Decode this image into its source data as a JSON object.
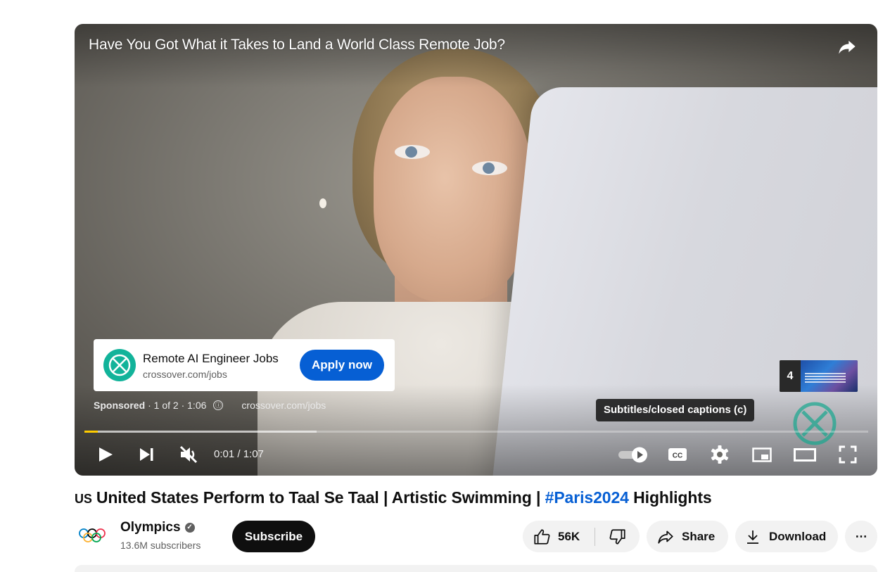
{
  "player": {
    "ad_title": "Have You Got What it Takes to Land a World Class Remote Job?",
    "ad_card": {
      "headline": "Remote AI Engineer Jobs",
      "domain": "crossover.com/jobs",
      "cta_label": "Apply now",
      "logo_icon": "crossover-logo-icon"
    },
    "sponsored": {
      "label": "Sponsored",
      "meta": "· 1 of 2 · 1:06",
      "info_icon": "ⓘ",
      "link": "crossover.com/jobs"
    },
    "preview": {
      "number": "4"
    },
    "tooltip": "Subtitles/closed captions (c)",
    "progress": {
      "played_fraction": 0.017,
      "buffered_fraction": 0.296
    },
    "time": "0:01 / 1:07",
    "accent_color": "#ffcc00"
  },
  "video": {
    "flag": "US",
    "title_main": "United States Perform to Taal Se Taal | Artistic Swimming | ",
    "hashtag": "#Paris2024",
    "title_end": " Highlights",
    "hashtag_color": "#065fd4"
  },
  "channel": {
    "name": "Olympics",
    "verified_mark": "✓",
    "subscribers": "13.6M subscribers",
    "subscribe_label": "Subscribe"
  },
  "actions": {
    "likes": "56K",
    "share_label": "Share",
    "download_label": "Download",
    "more_label": "⋯"
  }
}
